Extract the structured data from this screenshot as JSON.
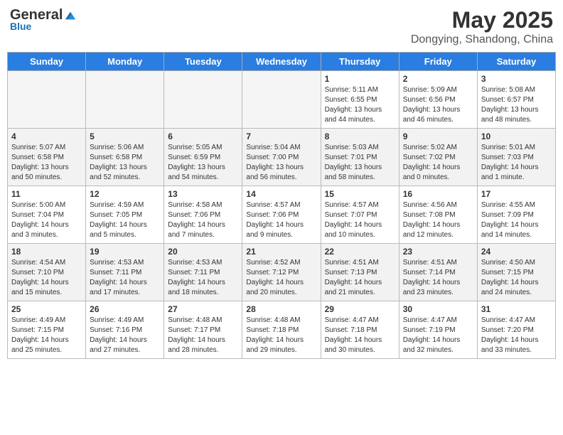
{
  "header": {
    "logo_general": "General",
    "logo_blue": "Blue",
    "month_year": "May 2025",
    "location": "Dongying, Shandong, China"
  },
  "weekdays": [
    "Sunday",
    "Monday",
    "Tuesday",
    "Wednesday",
    "Thursday",
    "Friday",
    "Saturday"
  ],
  "weeks": [
    [
      {
        "day": "",
        "empty": true
      },
      {
        "day": "",
        "empty": true
      },
      {
        "day": "",
        "empty": true
      },
      {
        "day": "",
        "empty": true
      },
      {
        "day": "1",
        "sunrise": "5:11 AM",
        "sunset": "6:55 PM",
        "daylight": "13 hours and 44 minutes."
      },
      {
        "day": "2",
        "sunrise": "5:09 AM",
        "sunset": "6:56 PM",
        "daylight": "13 hours and 46 minutes."
      },
      {
        "day": "3",
        "sunrise": "5:08 AM",
        "sunset": "6:57 PM",
        "daylight": "13 hours and 48 minutes."
      }
    ],
    [
      {
        "day": "4",
        "sunrise": "5:07 AM",
        "sunset": "6:58 PM",
        "daylight": "13 hours and 50 minutes."
      },
      {
        "day": "5",
        "sunrise": "5:06 AM",
        "sunset": "6:58 PM",
        "daylight": "13 hours and 52 minutes."
      },
      {
        "day": "6",
        "sunrise": "5:05 AM",
        "sunset": "6:59 PM",
        "daylight": "13 hours and 54 minutes."
      },
      {
        "day": "7",
        "sunrise": "5:04 AM",
        "sunset": "7:00 PM",
        "daylight": "13 hours and 56 minutes."
      },
      {
        "day": "8",
        "sunrise": "5:03 AM",
        "sunset": "7:01 PM",
        "daylight": "13 hours and 58 minutes."
      },
      {
        "day": "9",
        "sunrise": "5:02 AM",
        "sunset": "7:02 PM",
        "daylight": "14 hours and 0 minutes."
      },
      {
        "day": "10",
        "sunrise": "5:01 AM",
        "sunset": "7:03 PM",
        "daylight": "14 hours and 1 minute."
      }
    ],
    [
      {
        "day": "11",
        "sunrise": "5:00 AM",
        "sunset": "7:04 PM",
        "daylight": "14 hours and 3 minutes."
      },
      {
        "day": "12",
        "sunrise": "4:59 AM",
        "sunset": "7:05 PM",
        "daylight": "14 hours and 5 minutes."
      },
      {
        "day": "13",
        "sunrise": "4:58 AM",
        "sunset": "7:06 PM",
        "daylight": "14 hours and 7 minutes."
      },
      {
        "day": "14",
        "sunrise": "4:57 AM",
        "sunset": "7:06 PM",
        "daylight": "14 hours and 9 minutes."
      },
      {
        "day": "15",
        "sunrise": "4:57 AM",
        "sunset": "7:07 PM",
        "daylight": "14 hours and 10 minutes."
      },
      {
        "day": "16",
        "sunrise": "4:56 AM",
        "sunset": "7:08 PM",
        "daylight": "14 hours and 12 minutes."
      },
      {
        "day": "17",
        "sunrise": "4:55 AM",
        "sunset": "7:09 PM",
        "daylight": "14 hours and 14 minutes."
      }
    ],
    [
      {
        "day": "18",
        "sunrise": "4:54 AM",
        "sunset": "7:10 PM",
        "daylight": "14 hours and 15 minutes."
      },
      {
        "day": "19",
        "sunrise": "4:53 AM",
        "sunset": "7:11 PM",
        "daylight": "14 hours and 17 minutes."
      },
      {
        "day": "20",
        "sunrise": "4:53 AM",
        "sunset": "7:11 PM",
        "daylight": "14 hours and 18 minutes."
      },
      {
        "day": "21",
        "sunrise": "4:52 AM",
        "sunset": "7:12 PM",
        "daylight": "14 hours and 20 minutes."
      },
      {
        "day": "22",
        "sunrise": "4:51 AM",
        "sunset": "7:13 PM",
        "daylight": "14 hours and 21 minutes."
      },
      {
        "day": "23",
        "sunrise": "4:51 AM",
        "sunset": "7:14 PM",
        "daylight": "14 hours and 23 minutes."
      },
      {
        "day": "24",
        "sunrise": "4:50 AM",
        "sunset": "7:15 PM",
        "daylight": "14 hours and 24 minutes."
      }
    ],
    [
      {
        "day": "25",
        "sunrise": "4:49 AM",
        "sunset": "7:15 PM",
        "daylight": "14 hours and 25 minutes."
      },
      {
        "day": "26",
        "sunrise": "4:49 AM",
        "sunset": "7:16 PM",
        "daylight": "14 hours and 27 minutes."
      },
      {
        "day": "27",
        "sunrise": "4:48 AM",
        "sunset": "7:17 PM",
        "daylight": "14 hours and 28 minutes."
      },
      {
        "day": "28",
        "sunrise": "4:48 AM",
        "sunset": "7:18 PM",
        "daylight": "14 hours and 29 minutes."
      },
      {
        "day": "29",
        "sunrise": "4:47 AM",
        "sunset": "7:18 PM",
        "daylight": "14 hours and 30 minutes."
      },
      {
        "day": "30",
        "sunrise": "4:47 AM",
        "sunset": "7:19 PM",
        "daylight": "14 hours and 32 minutes."
      },
      {
        "day": "31",
        "sunrise": "4:47 AM",
        "sunset": "7:20 PM",
        "daylight": "14 hours and 33 minutes."
      }
    ]
  ],
  "labels": {
    "sunrise": "Sunrise:",
    "sunset": "Sunset:",
    "daylight": "Daylight:"
  }
}
